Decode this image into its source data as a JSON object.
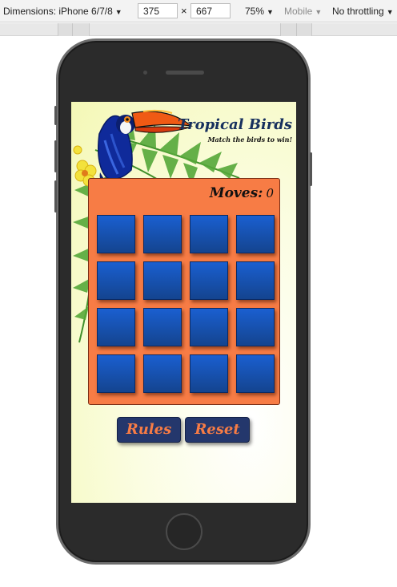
{
  "devtools": {
    "dimensions_label": "Dimensions: iPhone 6/7/8",
    "width_value": "375",
    "times_sign": "×",
    "height_value": "667",
    "zoom": "75%",
    "mode": "Mobile",
    "throttling": "No throttling"
  },
  "app": {
    "title": "Tropical Birds",
    "subtitle": "Match the birds to win!",
    "moves_label": "Moves:",
    "moves_count": "0",
    "card_count": 16,
    "rules_button": "Rules",
    "reset_button": "Reset"
  },
  "colors": {
    "board": "#f77c45",
    "card": "#1a5fd0",
    "button": "#24376c",
    "button_text": "#f77c45",
    "title": "#17305e"
  }
}
